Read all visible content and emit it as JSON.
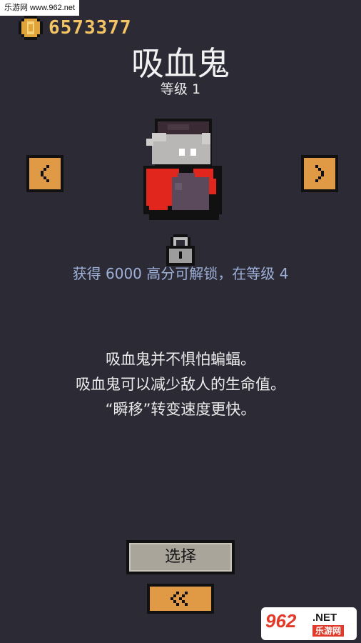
{
  "watermark": {
    "text": "乐游网 www.962.net"
  },
  "header": {
    "coins": "6573377"
  },
  "character": {
    "name": "吸血鬼",
    "level_label": "等级 1",
    "unlock_hint": "获得 6000 高分可解锁，在等级 4",
    "description": [
      "吸血鬼并不惧怕蝙蝠。",
      "吸血鬼可以减少敌人的生命值。",
      "“瞬移”转变速度更快。"
    ]
  },
  "buttons": {
    "select_label": "选择"
  },
  "logo": {
    "number": "962",
    "suffix": ".NET",
    "cn": "乐游网"
  },
  "colors": {
    "background": "#2b2a35",
    "coin_text": "#f2c463",
    "button_orange": "#e09a45",
    "select_gray": "#a9a59b",
    "unlock_text": "#9fb1d9",
    "vampire_cape": "#e1261d"
  },
  "icons": {
    "coin": "coin-icon",
    "prev": "chevron-left-icon",
    "next": "chevron-right-icon",
    "lock": "lock-icon",
    "back": "double-chevron-left-icon"
  }
}
